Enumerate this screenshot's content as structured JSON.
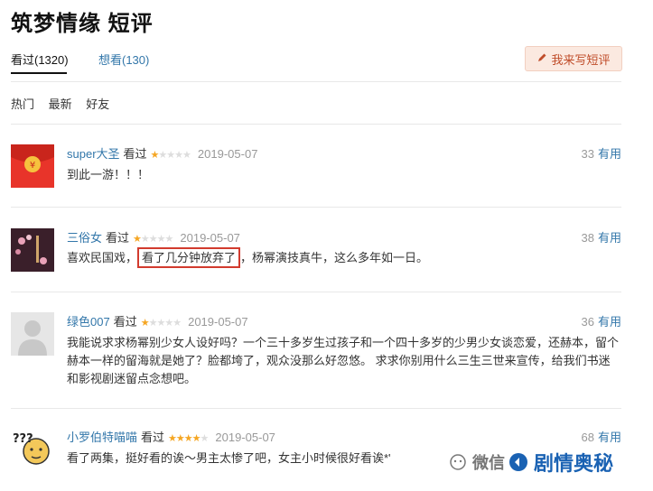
{
  "page": {
    "title": "筑梦情缘 短评"
  },
  "tabs": [
    {
      "label": "看过(1320)"
    },
    {
      "label": "想看(130)"
    }
  ],
  "write_button": {
    "label": "我来写短评"
  },
  "filters": [
    "热门",
    "最新",
    "好友"
  ],
  "comments": [
    {
      "user": "super大圣",
      "status": "看过",
      "rating": 1,
      "date": "2019-05-07",
      "votes": "33",
      "vote_label": "有用",
      "text": "到此一游！！！"
    },
    {
      "user": "三俗女",
      "status": "看过",
      "rating": 1,
      "date": "2019-05-07",
      "votes": "38",
      "vote_label": "有用",
      "text_before": "喜欢民国戏，",
      "text_highlight": "看了几分钟放弃了",
      "text_after": "，杨幂演技真牛，这么多年如一日。"
    },
    {
      "user": "绿色007",
      "status": "看过",
      "rating": 1,
      "date": "2019-05-07",
      "votes": "36",
      "vote_label": "有用",
      "text": "我能说求求杨幂别少女人设好吗？一个三十多岁生过孩子和一个四十多岁的少男少女谈恋爱，还赫本，留个赫本一样的留海就是她了？脸都垮了，观众没那么好忽悠。 求求你别用什么三生三世来宣传，给我们书迷和影视剧迷留点念想吧。"
    },
    {
      "user": "小罗伯特喵喵",
      "status": "看过",
      "rating": 4,
      "date": "2019-05-07",
      "votes": "68",
      "vote_label": "有用",
      "text": "看了两集，挺好看的诶～男主太惨了吧，女主小时候很好看诶*'"
    }
  ],
  "watermark": {
    "prefix": "微信",
    "brand": "剧情奥秘"
  },
  "colors": {
    "link": "#3377aa",
    "star": "#f5a623",
    "highlight_border": "#d23b2e"
  }
}
